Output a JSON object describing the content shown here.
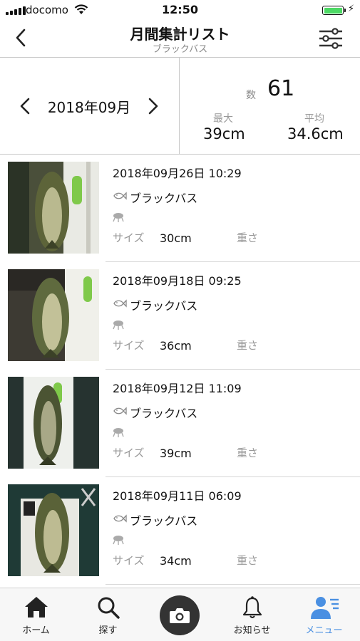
{
  "status_bar": {
    "carrier": "docomo",
    "time": "12:50",
    "battery_level": 1.0
  },
  "header": {
    "title": "月間集計リスト",
    "subtitle": "ブラックバス",
    "back_icon": "chevron-left-icon",
    "filter_icon": "sliders-icon"
  },
  "summary": {
    "month": "2018年09月",
    "count_label": "数",
    "count_value": "61",
    "max_label": "最大",
    "max_value": "39cm",
    "avg_label": "平均",
    "avg_value": "34.6cm"
  },
  "catches": [
    {
      "date": "2018年09月26日 10:29",
      "species": "ブラックバス",
      "size_label": "サイズ",
      "size": "30cm",
      "weight_label": "重さ"
    },
    {
      "date": "2018年09月18日 09:25",
      "species": "ブラックバス",
      "size_label": "サイズ",
      "size": "36cm",
      "weight_label": "重さ"
    },
    {
      "date": "2018年09月12日 11:09",
      "species": "ブラックバス",
      "size_label": "サイズ",
      "size": "39cm",
      "weight_label": "重さ"
    },
    {
      "date": "2018年09月11日 06:09",
      "species": "ブラックバス",
      "size_label": "サイズ",
      "size": "34cm",
      "weight_label": "重さ"
    }
  ],
  "tabbar": {
    "home": "ホーム",
    "search": "探す",
    "notifications": "お知らせ",
    "menu": "メニュー",
    "active_tab": "menu",
    "active_color": "#4a90e2"
  }
}
